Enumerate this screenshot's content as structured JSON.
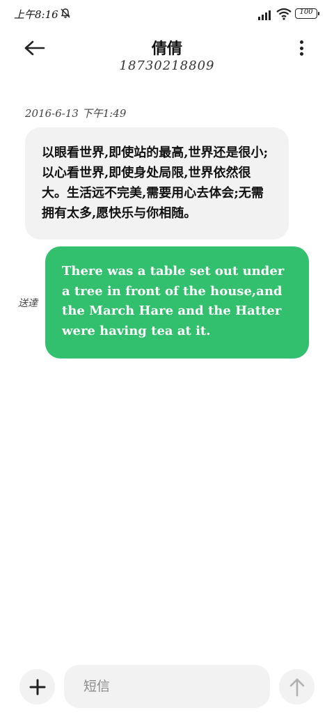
{
  "status_bar": {
    "time": "上午8:16",
    "battery": "100",
    "icons": [
      "mute-icon",
      "signal-icon",
      "wifi-icon",
      "battery-icon"
    ]
  },
  "header": {
    "contact_name": "倩倩",
    "contact_number": "18730218809",
    "icons": [
      "back-arrow-icon",
      "more-vertical-icon"
    ]
  },
  "conversation": {
    "timestamp": "2016-6-13 下午1:49",
    "messages": [
      {
        "direction": "incoming",
        "text": "以眼看世界,即使站的最高,世界还是很小;以心看世界,即使身处局限,世界依然很大。生活远不完美,需要用心去体会;无需拥有太多,愿快乐与你相随。"
      },
      {
        "direction": "outgoing",
        "text": "There was a table set out under a tree in front of the house,and the March Hare and the Hatter were having tea at it.",
        "status": "送達"
      }
    ]
  },
  "composer": {
    "placeholder": "短信",
    "value": "",
    "icons": [
      "plus-icon",
      "send-arrow-icon"
    ]
  },
  "colors": {
    "outgoing_bubble": "#33c06e",
    "incoming_bubble": "#f2f2f2",
    "button_bg": "#f2f2f2"
  }
}
